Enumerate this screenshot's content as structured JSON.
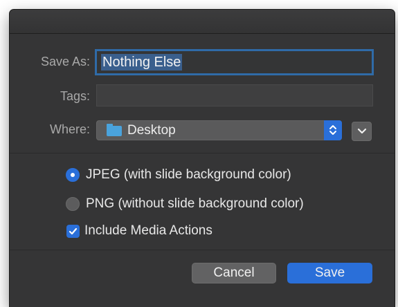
{
  "dialog": {
    "save_as_label": "Save As:",
    "save_as_value": "Nothing Else",
    "tags_label": "Tags:",
    "tags_value": "",
    "where_label": "Where:",
    "where_value": "Desktop",
    "where_icon": "folder-icon"
  },
  "options": {
    "jpeg_label": "JPEG (with slide background color)",
    "jpeg_selected": true,
    "png_label": "PNG (without slide background color)",
    "png_selected": false,
    "media_label": "Include Media Actions",
    "media_checked": true
  },
  "buttons": {
    "cancel_label": "Cancel",
    "save_label": "Save"
  },
  "colors": {
    "accent": "#2a6fd9",
    "dialog_bg": "#353536"
  }
}
